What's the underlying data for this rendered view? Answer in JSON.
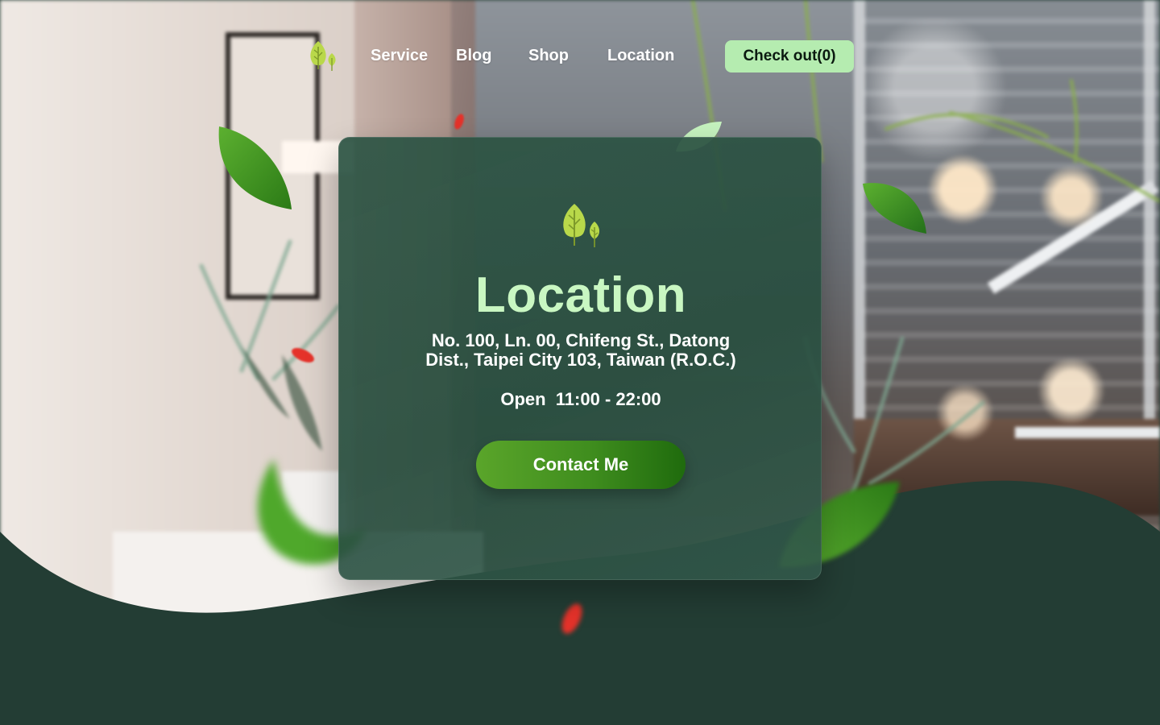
{
  "nav": {
    "items": [
      {
        "label": "Service"
      },
      {
        "label": "Blog"
      },
      {
        "label": "Shop"
      },
      {
        "label": "Location"
      }
    ],
    "checkout_label": "Check out(0)"
  },
  "card": {
    "title": "Location",
    "address": "No. 100, Ln. 00, Chifeng St., Datong Dist., Taipei City 103, Taiwan (R.O.C.)",
    "hours": "Open  11:00 - 22:00",
    "button_label": "Contact Me"
  },
  "icons": {
    "logo": "tree-logo-icon",
    "decor": "falling-leaf-icon"
  },
  "colors": {
    "accent": "#c9f7c2",
    "checkout_bg": "#b5ecb0",
    "button_green": "#3f8d1e",
    "wave_dark": "#233d34",
    "logo_green": "#b9d84a"
  }
}
